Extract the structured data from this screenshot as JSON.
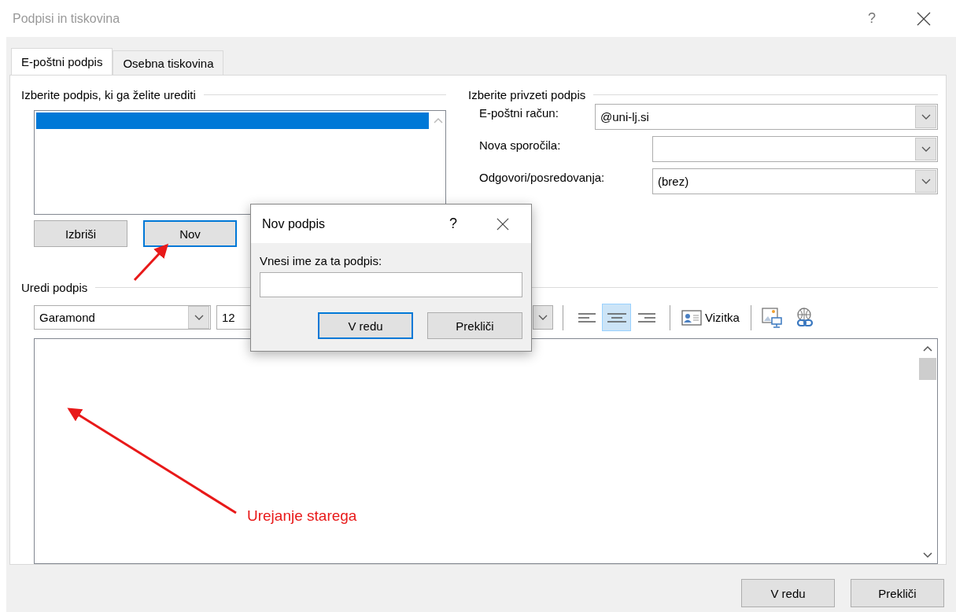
{
  "window": {
    "title": "Podpisi in tiskovina",
    "help": "?"
  },
  "tabs": [
    {
      "label": "E-poštni podpis",
      "selected": true
    },
    {
      "label": "Osebna tiskovina",
      "selected": false
    }
  ],
  "select_section": {
    "heading": "Izberite podpis, ki ga želite urediti",
    "signatures": [
      {
        "selected": true
      }
    ],
    "buttons": [
      {
        "label": "Izbriši",
        "focused": false
      },
      {
        "label": "Nov",
        "focused": true
      }
    ]
  },
  "default_section": {
    "heading": "Izberite privzeti podpis",
    "fields": [
      {
        "label": "E-poštni račun:",
        "value": "@uni-lj.si"
      },
      {
        "label": "Nova sporočila:"
      },
      {
        "label": "Odgovori/posredovanja:",
        "value": "(brez)"
      }
    ]
  },
  "editor": {
    "heading": "Uredi podpis",
    "font": "Garamond",
    "size": "12",
    "alignments": [
      {
        "kind": "left",
        "selected": false
      },
      {
        "kind": "center",
        "selected": true
      },
      {
        "kind": "right",
        "selected": false
      }
    ],
    "business_card": "Vizitka"
  },
  "footer_buttons": [
    {
      "label": "V redu"
    },
    {
      "label": "Prekliči"
    }
  ],
  "dialog": {
    "title": "Nov podpis",
    "help": "?",
    "prompt": "Vnesi ime za ta podpis:",
    "buttons": [
      {
        "label": "V redu",
        "focused": true
      },
      {
        "label": "Prekliči",
        "focused": false
      }
    ]
  },
  "annotation": {
    "text": "Urejanje starega"
  }
}
